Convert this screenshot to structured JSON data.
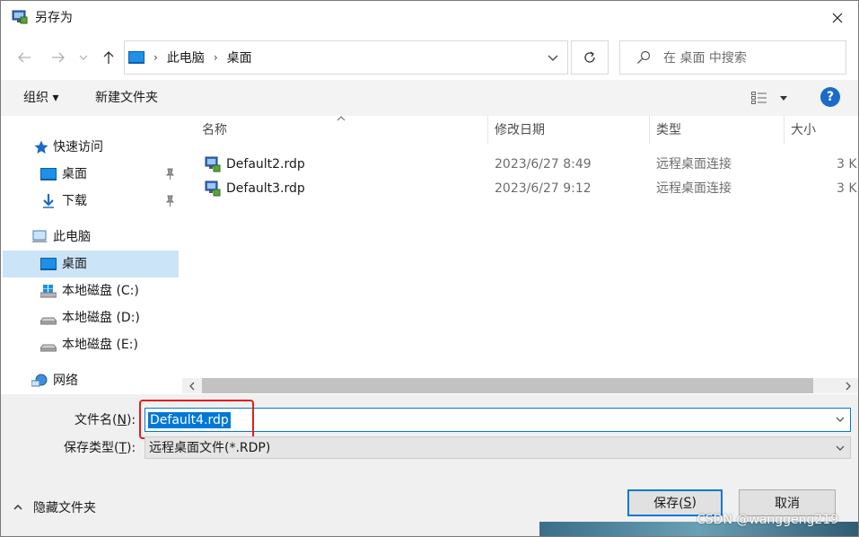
{
  "window": {
    "title": "另存为"
  },
  "nav": {
    "breadcrumb": [
      "此电脑",
      "桌面"
    ],
    "search_placeholder": "在 桌面 中搜索"
  },
  "toolbar": {
    "organize": "组织 ▾",
    "new_folder": "新建文件夹",
    "help": "?"
  },
  "sidebar": {
    "quick_access": "快速访问",
    "qa_desktop": "桌面",
    "qa_downloads": "下载",
    "this_pc": "此电脑",
    "pc_desktop": "桌面",
    "drive_c": "本地磁盘 (C:)",
    "drive_d": "本地磁盘 (D:)",
    "drive_e": "本地磁盘 (E:)",
    "network": "网络"
  },
  "columns": {
    "name": "名称",
    "modified": "修改日期",
    "type": "类型",
    "size": "大小"
  },
  "files": [
    {
      "name": "Default2.rdp",
      "modified": "2023/6/27 8:49",
      "type": "远程桌面连接",
      "size": "3 K"
    },
    {
      "name": "Default3.rdp",
      "modified": "2023/6/27 9:12",
      "type": "远程桌面连接",
      "size": "3 K"
    }
  ],
  "form": {
    "filename_label_pre": "文件名(",
    "filename_label_key": "N",
    "filename_label_post": "):",
    "filename_value": "Default4.rdp",
    "filetype_label_pre": "保存类型(",
    "filetype_label_key": "T",
    "filetype_label_post": "):",
    "filetype_value": "远程桌面文件(*.RDP)"
  },
  "footer": {
    "hide_folders": "隐藏文件夹",
    "save_pre": "保存(",
    "save_key": "S",
    "save_post": ")",
    "cancel": "取消",
    "watermark": "CSDN @wanggeng219"
  },
  "colors": {
    "accent": "#0078d7",
    "selection": "#cce4f7",
    "highlight_box": "#e1201b"
  }
}
